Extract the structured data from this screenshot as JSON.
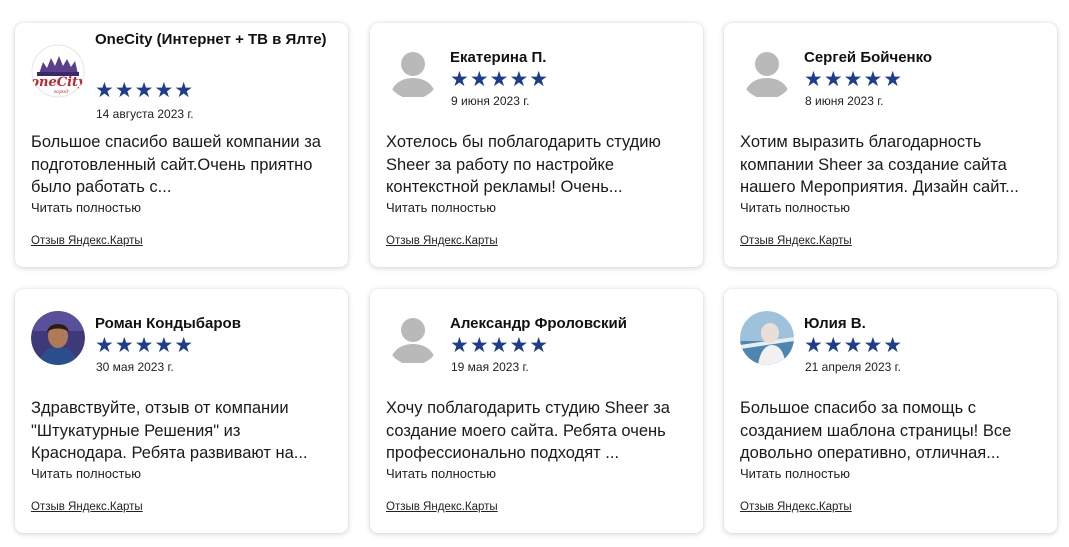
{
  "colors": {
    "star": "#1f3d8f",
    "placeholder_avatar": "#b9b9b9"
  },
  "reviews": [
    {
      "author": "OneCity (Интернет + ТВ в Ялте)",
      "avatar": "onecity-logo",
      "rating": 5,
      "stars": "★★★★★",
      "date": "14 августа 2023 г.",
      "text": "Большое спасибо вашей компании за подготовленный сайт.Очень приятно было работать с...",
      "read_more": "Читать полностью",
      "source": "Отзыв Яндекс.Карты"
    },
    {
      "author": "Екатерина П.",
      "avatar": "placeholder-user",
      "rating": 5,
      "stars": "★★★★★",
      "date": "9 июня 2023 г.",
      "text": "Хотелось бы поблагодарить студию Sheer за работу по настройке контекстной рекламы! Очень...",
      "read_more": "Читать полностью",
      "source": "Отзыв Яндекс.Карты"
    },
    {
      "author": "Сергей Бойченко",
      "avatar": "placeholder-user",
      "rating": 5,
      "stars": "★★★★★",
      "date": "8 июня 2023 г.",
      "text": "Хотим выразить благодарность компании Sheer за создание сайта нашего Мероприятия. Дизайн сайт...",
      "read_more": "Читать полностью",
      "source": "Отзыв Яндекс.Карты"
    },
    {
      "author": "Роман Кондыбаров",
      "avatar": "photo-man",
      "rating": 5,
      "stars": "★★★★★",
      "date": "30 мая 2023 г.",
      "text": "Здравствуйте, отзыв от компании \"Штукатурные Решения\" из Краснодара. Ребята развивают на...",
      "read_more": "Читать полностью",
      "source": "Отзыв Яндекс.Карты"
    },
    {
      "author": "Александр Фроловский",
      "avatar": "placeholder-user",
      "rating": 5,
      "stars": "★★★★★",
      "date": "19 мая 2023 г.",
      "text": "Хочу поблагодарить студию Sheer за создание моего сайта. Ребята очень профессионально подходят ...",
      "read_more": "Читать полностью",
      "source": "Отзыв Яндекс.Карты"
    },
    {
      "author": "Юлия В.",
      "avatar": "photo-woman",
      "rating": 5,
      "stars": "★★★★★",
      "date": "21 апреля 2023 г.",
      "text": "Большое спасибо за помощь с созданием шаблона страницы! Все довольно оперативно, отличная...",
      "read_more": "Читать полностью",
      "source": "Отзыв Яндекс.Карты"
    }
  ]
}
